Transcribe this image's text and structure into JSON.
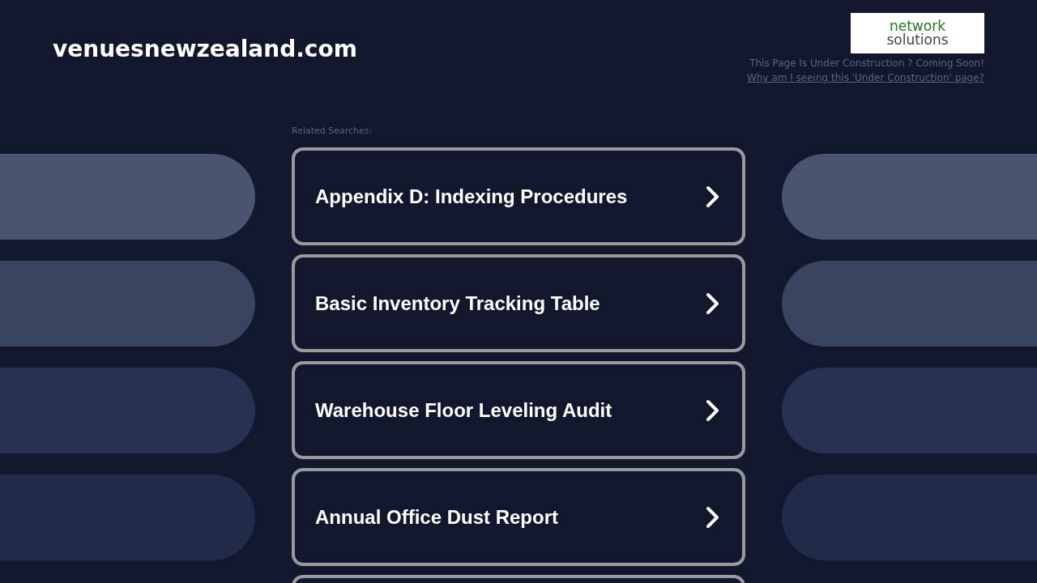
{
  "site_title": "venuesnewzealand.com",
  "logo": {
    "line_1": "network",
    "line_2": "solutions"
  },
  "notice": "This Page Is Under Construction ? Coming Soon!",
  "notice_link": "Why am I seeing this 'Under Construction' page?",
  "related_label": "Related Searches:",
  "searches": [
    {
      "label": "Appendix D: Indexing Procedures"
    },
    {
      "label": "Basic Inventory Tracking Table"
    },
    {
      "label": "Warehouse Floor Leveling Audit"
    },
    {
      "label": "Annual Office Dust Report"
    }
  ]
}
